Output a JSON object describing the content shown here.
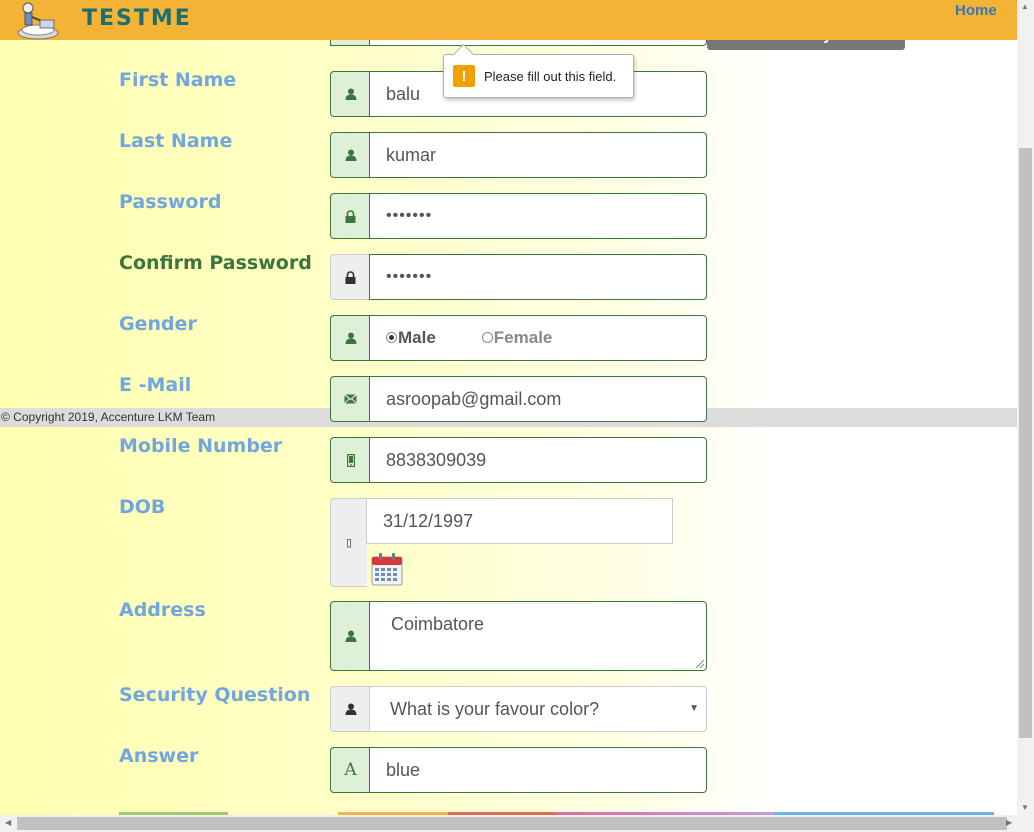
{
  "header": {
    "brand": "TESTME",
    "home_link": "Home"
  },
  "hidden_badge": "Name Already Exists",
  "tooltip": {
    "message": "Please fill out this field.",
    "icon": "warning-icon"
  },
  "form": {
    "first_name": {
      "label": "First Name",
      "value": "balu",
      "icon": "user-icon"
    },
    "last_name": {
      "label": "Last Name",
      "value": "kumar",
      "icon": "user-icon"
    },
    "password": {
      "label": "Password",
      "value": "•••••••",
      "icon": "lock-icon"
    },
    "confirm_password": {
      "label": "Confirm Password",
      "value": "•••••••",
      "icon": "lock-icon"
    },
    "gender": {
      "label": "Gender",
      "options": [
        "Male",
        "Female"
      ],
      "selected": "Male",
      "icon": "user-icon"
    },
    "email": {
      "label": "E -Mail",
      "value": "asroopab@gmail.com",
      "icon": "envelope-icon"
    },
    "mobile": {
      "label": "Mobile Number",
      "value": "8838309039",
      "icon": "phone-icon"
    },
    "dob": {
      "label": "DOB",
      "value": "31/12/1997",
      "icon_glyph": "▯"
    },
    "address": {
      "label": "Address",
      "value": "Coimbatore",
      "icon": "user-icon"
    },
    "security_question": {
      "label": "Security Question",
      "value": "What is your favour color?",
      "icon": "user-icon"
    },
    "answer": {
      "label": "Answer",
      "value": "blue",
      "icon_glyph": "A"
    }
  },
  "footer": {
    "copyright": "© Copyright 2019, Accenture LKM Team"
  },
  "colors": {
    "header": "#f5b335",
    "label": "#72a6e0",
    "success": "#3c763d",
    "addon_bg": "#dff0d8"
  }
}
